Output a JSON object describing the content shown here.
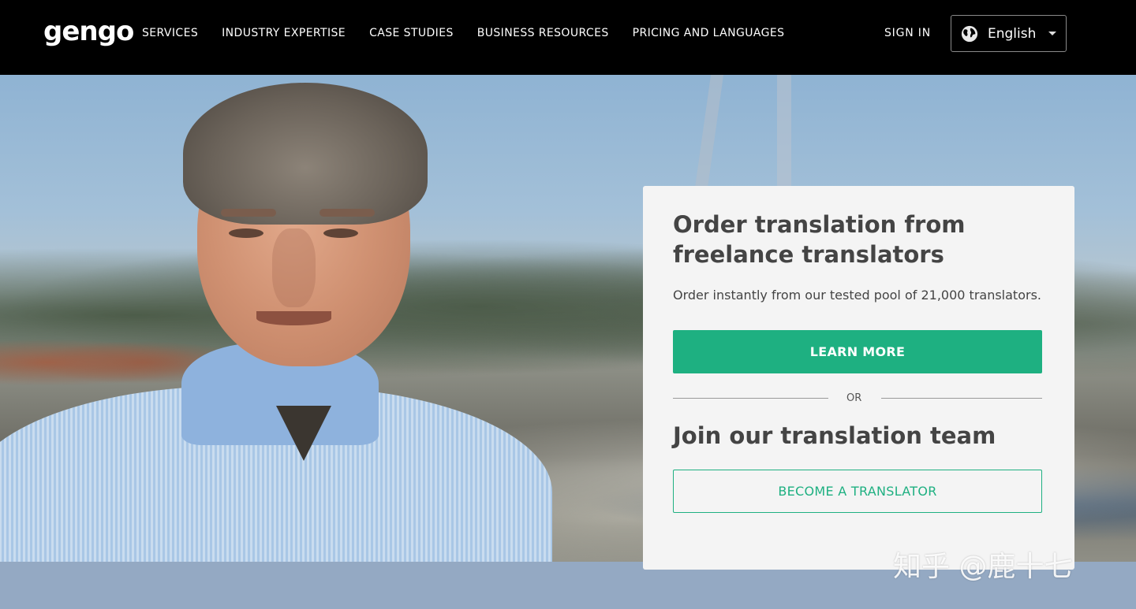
{
  "header": {
    "logo": "gengo",
    "nav": [
      "SERVICES",
      "INDUSTRY EXPERTISE",
      "CASE STUDIES",
      "BUSINESS RESOURCES",
      "PRICING AND LANGUAGES"
    ],
    "sign_in": "SIGN IN",
    "language": "English"
  },
  "hero": {
    "title": "Order translation from freelance translators",
    "subtitle": "Order instantly from our tested pool of 21,000 translators.",
    "learn_more": "LEARN MORE",
    "or": "OR",
    "join_title": "Join our translation team",
    "become_translator": "BECOME A TRANSLATOR"
  },
  "watermark": "知乎 @鹿十七",
  "colors": {
    "accent": "#1eb081",
    "header_bg": "#000000",
    "card_bg": "#f4f4f4"
  }
}
